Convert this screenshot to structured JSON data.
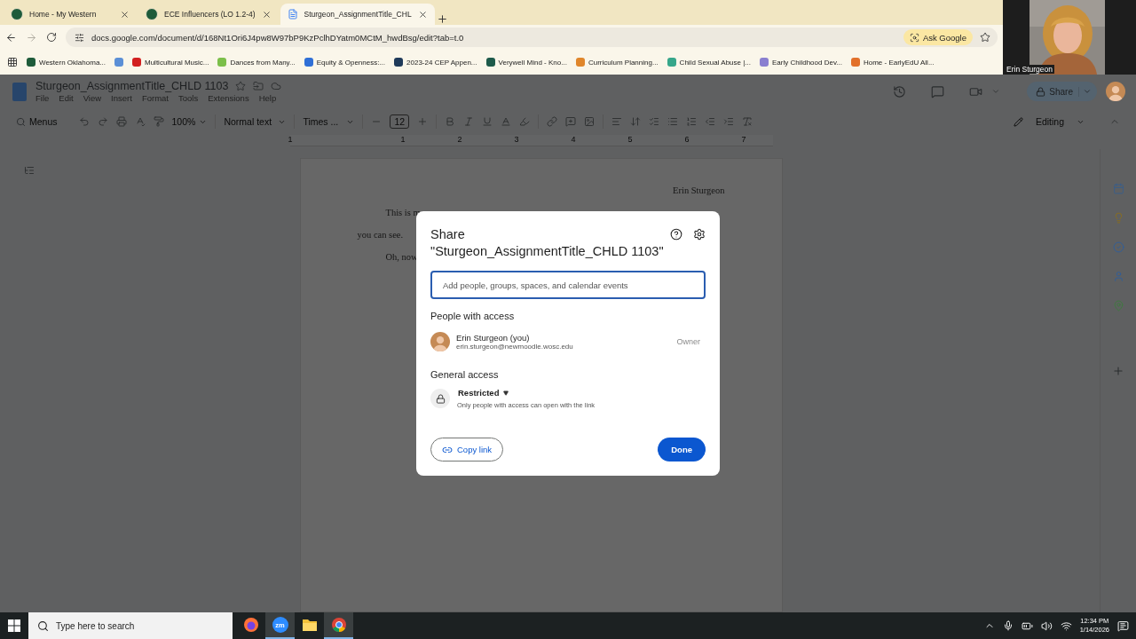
{
  "browser": {
    "tabs": [
      {
        "title": "Home - My Western",
        "selected": false,
        "kind": "western"
      },
      {
        "title": "ECE Influencers (LO 1.2-4)",
        "selected": false,
        "kind": "western"
      },
      {
        "title": "Sturgeon_AssignmentTitle_CHL",
        "selected": true,
        "kind": "docs"
      }
    ],
    "forward_disabled": true,
    "url": "docs.google.com/document/d/168Nt1Ori6J4pw8W97bP9KzPclhDYatm0MCtM_hwdBsg/edit?tab=t.0",
    "ask_button": "Ask Google",
    "bookmarks": [
      {
        "label": "Western Oklahoma...",
        "color": "#1e5b3a"
      },
      {
        "color": "#5b8fd6"
      },
      {
        "label": "Multicultural Music...",
        "color": "#d21f1f"
      },
      {
        "label": "Dances from Many...",
        "color": "#7cbf4a"
      },
      {
        "label": "Equity & Openness:...",
        "color": "#2f6fd6"
      },
      {
        "label": "2023-24 CEP Appen...",
        "color": "#1f3a5a"
      },
      {
        "label": "Verywell Mind - Kno...",
        "color": "#1d5a4a"
      },
      {
        "label": "Curriculum Planning...",
        "color": "#e0862b"
      },
      {
        "label": "Child Sexual Abuse |...",
        "color": "#36a68a"
      },
      {
        "label": "Early Childhood Dev...",
        "color": "#8a7fd0"
      },
      {
        "label": "Home - EarlyEdU All...",
        "color": "#e2702a"
      }
    ]
  },
  "video": {
    "name": "Erin Sturgeon"
  },
  "docs": {
    "title": "Sturgeon_AssignmentTitle_CHLD 1103",
    "menu": [
      "File",
      "Edit",
      "View",
      "Insert",
      "Format",
      "Tools",
      "Extensions",
      "Help"
    ],
    "toolbar": {
      "search": "Menus",
      "zoom": "100%",
      "style": "Normal text",
      "font": "Times ...",
      "font_size": "12",
      "mode": "Editing"
    },
    "share": "Share",
    "ruler": [
      "1",
      "1",
      "2",
      "3",
      "4",
      "5",
      "6",
      "7"
    ],
    "lines": [
      {
        "text": "Erin Sturgeon",
        "kind": "right"
      },
      {
        "text": "This is m",
        "kind": "indent"
      },
      {
        "text": "you can see.",
        "kind": "plain"
      },
      {
        "text": "Oh, now",
        "kind": "indent"
      }
    ]
  },
  "dialog": {
    "heading": "Share",
    "doc_title": "\"Sturgeon_AssignmentTitle_CHLD 1103\"",
    "placeholder": "Add people, groups, spaces, and calendar events",
    "people_heading": "People with access",
    "people": [
      {
        "name": "Erin Sturgeon (you)",
        "email": "erin.sturgeon@newmoodle.wosc.edu",
        "role": "Owner"
      }
    ],
    "general_heading": "General access",
    "access": "Restricted",
    "access_note": "Only people with access can open with the link",
    "copy_link": "Copy link",
    "done": "Done"
  },
  "taskbar": {
    "search_placeholder": "Type here to search",
    "apps": [
      {
        "kind": "firefox",
        "active": false
      },
      {
        "kind": "zoom",
        "label": "zm",
        "active": true
      },
      {
        "kind": "files",
        "active": false
      },
      {
        "kind": "chrome",
        "active": true
      }
    ],
    "time": "12:34 PM",
    "date": "1/14/2026"
  }
}
